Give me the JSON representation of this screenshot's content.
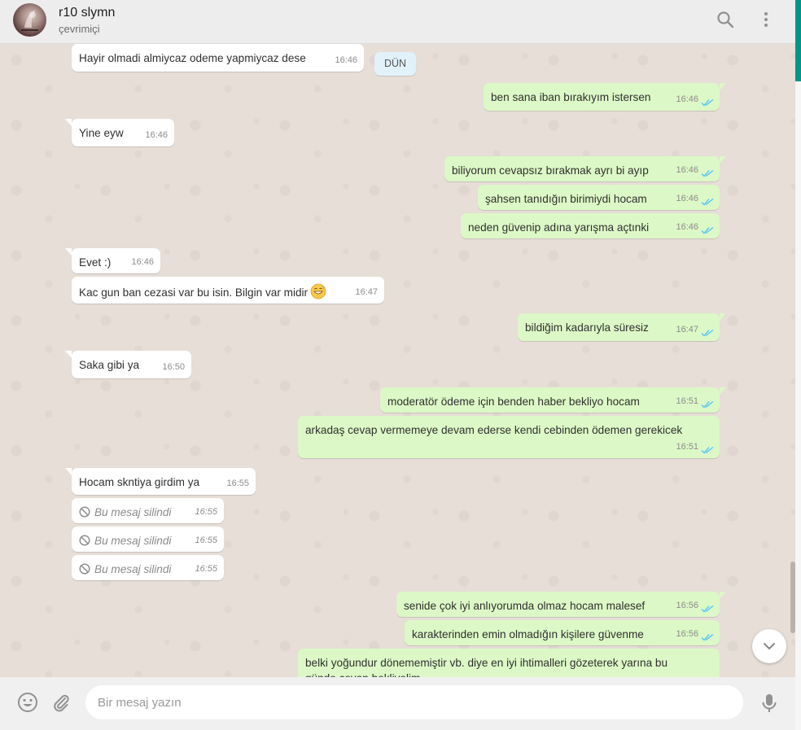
{
  "header": {
    "contact_name": "r10 slymn",
    "contact_status": "çevrimiçi",
    "icons": [
      "search-icon",
      "menu-icon"
    ]
  },
  "date_chip": "DÜN",
  "messages": [
    {
      "dir": "in",
      "text": "Hayir olmadi almiycaz odeme yapmiycaz dese",
      "time": "16:46"
    },
    {
      "dir": "out",
      "text": "ben sana iban bırakıyım istersen",
      "time": "16:46",
      "status": "read"
    },
    {
      "dir": "in",
      "text": "Yine eyw",
      "time": "16:46"
    },
    {
      "dir": "out",
      "text": "biliyorum cevapsız bırakmak ayrı bi ayıp",
      "time": "16:46",
      "status": "read"
    },
    {
      "dir": "out",
      "text": "şahsen tanıdığın birimiydi hocam",
      "time": "16:46",
      "status": "read"
    },
    {
      "dir": "out",
      "text": "neden güvenip adına yarışma açtınki",
      "time": "16:46",
      "status": "read"
    },
    {
      "dir": "in",
      "text": "Evet :)",
      "time": "16:46"
    },
    {
      "dir": "in",
      "text": "Kac gun ban cezasi var bu isin. Bilgin var midir",
      "emoji": "grinning-sweat-emoji",
      "time": "16:47"
    },
    {
      "dir": "out",
      "text": "bildiğim kadarıyla süresiz",
      "time": "16:47",
      "status": "read"
    },
    {
      "dir": "in",
      "text": "Saka gibi ya",
      "time": "16:50"
    },
    {
      "dir": "out",
      "text": "moderatör ödeme için benden haber bekliyo hocam",
      "time": "16:51",
      "status": "read"
    },
    {
      "dir": "out",
      "text": "arkadaş cevap vermemeye devam ederse kendi cebinden ödemen gerekicek",
      "time": "16:51",
      "status": "read"
    },
    {
      "dir": "in",
      "text": "Hocam skntiya girdim ya",
      "time": "16:55"
    },
    {
      "dir": "in",
      "text": "Bu mesaj silindi",
      "time": "16:55",
      "deleted": true
    },
    {
      "dir": "in",
      "text": "Bu mesaj silindi",
      "time": "16:55",
      "deleted": true
    },
    {
      "dir": "in",
      "text": "Bu mesaj silindi",
      "time": "16:55",
      "deleted": true
    },
    {
      "dir": "out",
      "text": "senide çok iyi anlıyorumda olmaz hocam malesef",
      "time": "16:56",
      "status": "read"
    },
    {
      "dir": "out",
      "text": "karakterinden emin olmadığın kişilere güvenme",
      "time": "16:56",
      "status": "read"
    },
    {
      "dir": "out",
      "text": "belki yoğundur dönememiştir vb. diye en iyi ihtimalleri gözeterek yarına bu",
      "text2": "günde cevap bekliyelim"
    }
  ],
  "composer": {
    "placeholder": "Bir mesaj yazın",
    "icons": [
      "emoji-icon",
      "attach-icon",
      "mic-icon"
    ]
  },
  "colors": {
    "outgoing_bubble": "#dcf8c6",
    "incoming_bubble": "#ffffff",
    "read_ticks": "#4fc3f7",
    "header_bg": "#ededed"
  }
}
